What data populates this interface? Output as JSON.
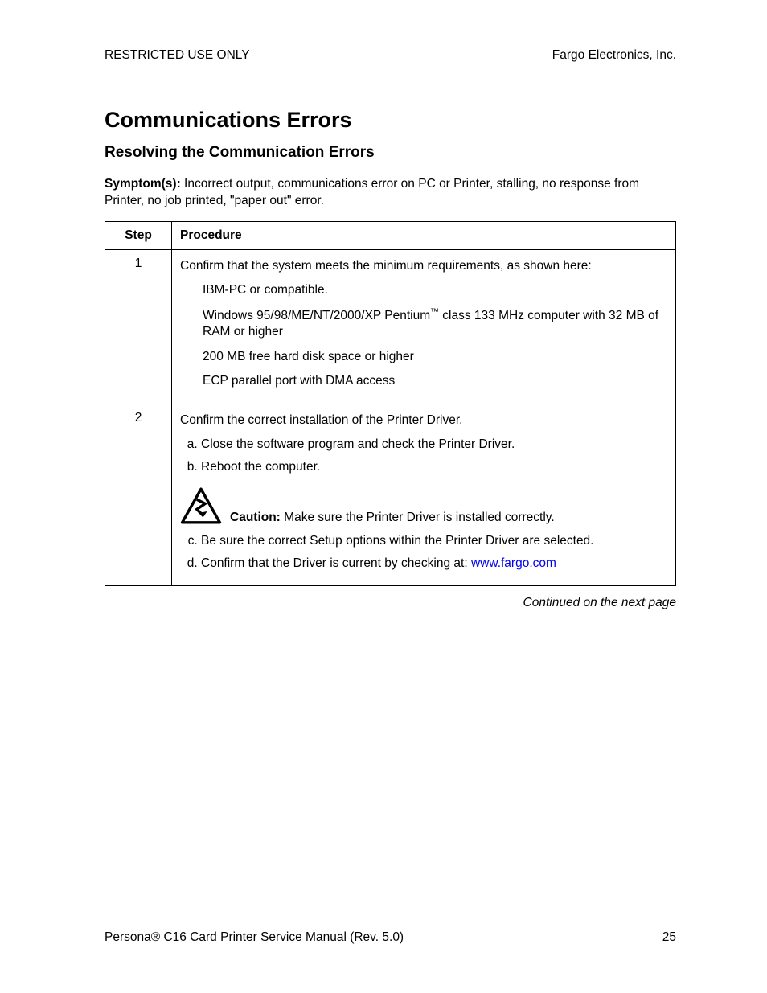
{
  "header": {
    "left": "RESTRICTED USE ONLY",
    "right": "Fargo Electronics, Inc."
  },
  "title": "Communications Errors",
  "subtitle": "Resolving the Communication Errors",
  "symptoms_label": "Symptom(s):",
  "symptoms_text": "  Incorrect output, communications error on PC or Printer, stalling, no response from Printer, no job printed, \"paper out\" error.",
  "table": {
    "col_step": "Step",
    "col_proc": "Procedure",
    "row1": {
      "step": "1",
      "intro": "Confirm that the system meets the minimum requirements, as shown here:",
      "req_a": "IBM-PC or compatible.",
      "req_b_pre": "Windows 95/98/ME/NT/2000/XP Pentium",
      "req_b_tm": "™",
      "req_b_post": " class 133 MHz computer with 32 MB of RAM or higher",
      "req_c": "200 MB free hard disk space or higher",
      "req_d": "ECP parallel port with DMA access"
    },
    "row2": {
      "step": "2",
      "intro": "Confirm the correct installation of the Printer Driver.",
      "a": "Close the software program and check the Printer Driver.",
      "b": "Reboot the computer.",
      "caution_label": "Caution:",
      "caution_text": "  Make sure the Printer Driver is installed correctly.",
      "c": "Be sure the correct Setup options within the Printer Driver are selected.",
      "d_pre": "Confirm that the Driver is current by checking at: ",
      "d_link": "www.fargo.com"
    }
  },
  "continued": "Continued on the next page",
  "footer": {
    "left_pre": "Persona",
    "left_reg": "®",
    "left_post": " C16 Card Printer Service Manual (Rev. 5.0)",
    "page": "25"
  }
}
